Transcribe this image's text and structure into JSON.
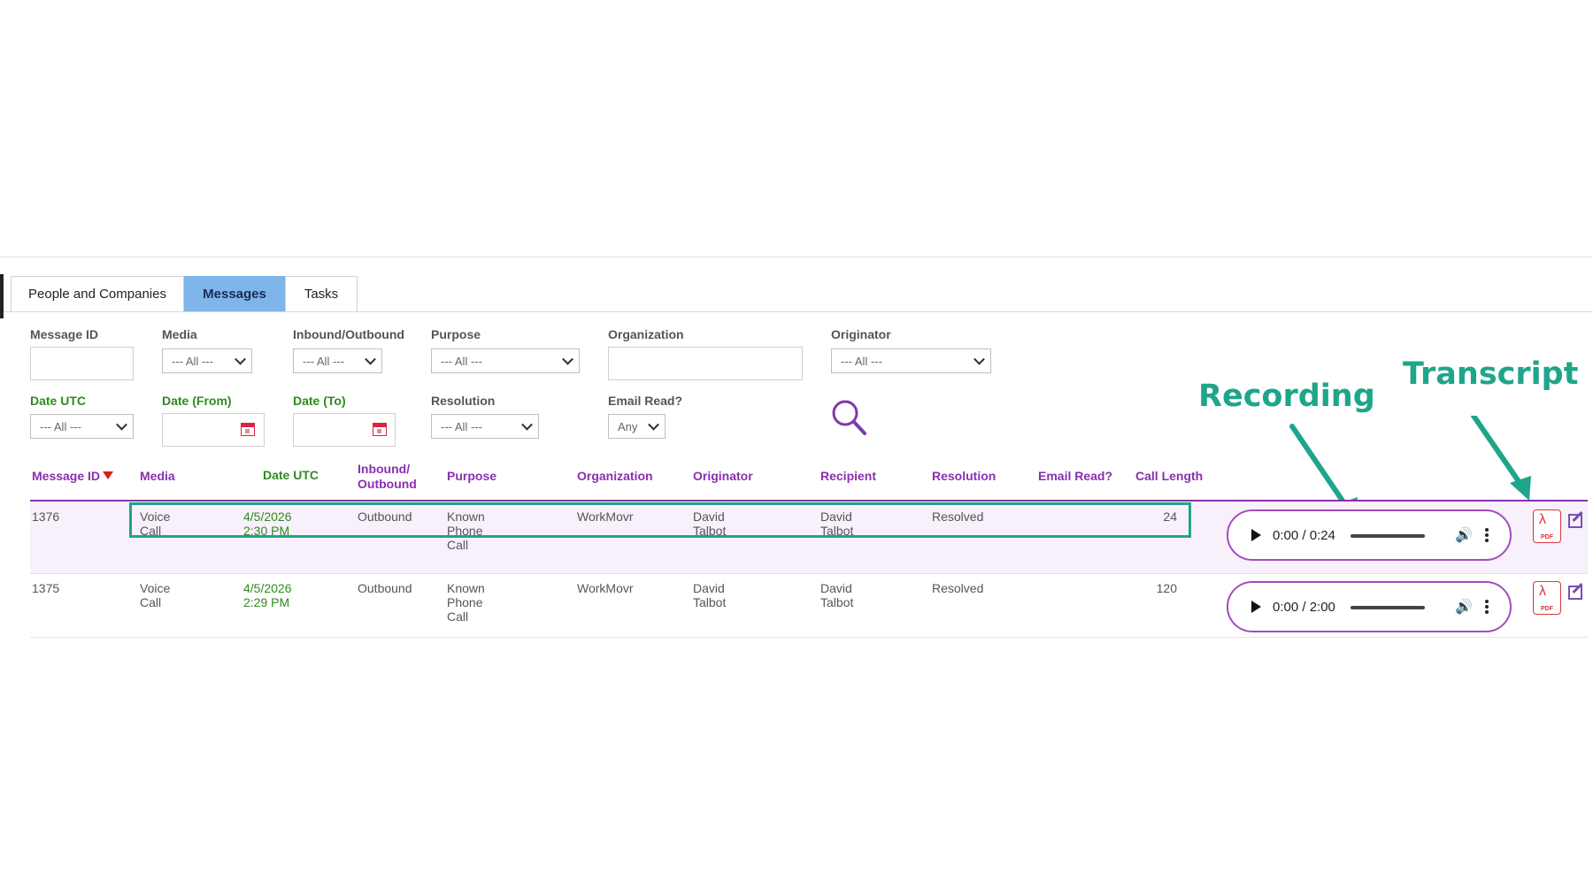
{
  "tabs": [
    {
      "label": "People and Companies",
      "active": false
    },
    {
      "label": "Messages",
      "active": true
    },
    {
      "label": "Tasks",
      "active": false
    }
  ],
  "filters": {
    "message_id": {
      "label": "Message ID",
      "value": ""
    },
    "media": {
      "label": "Media",
      "value": "--- All ---"
    },
    "inbound_outbound": {
      "label": "Inbound/Outbound",
      "value": "--- All ---"
    },
    "purpose": {
      "label": "Purpose",
      "value": "--- All ---"
    },
    "organization": {
      "label": "Organization",
      "value": ""
    },
    "originator": {
      "label": "Originator",
      "value": "--- All ---"
    },
    "date_utc": {
      "label": "Date UTC",
      "value": "--- All ---"
    },
    "date_from": {
      "label": "Date (From)",
      "value": ""
    },
    "date_to": {
      "label": "Date (To)",
      "value": ""
    },
    "resolution": {
      "label": "Resolution",
      "value": "--- All ---"
    },
    "email_read": {
      "label": "Email Read?",
      "value": "Any"
    }
  },
  "table": {
    "columns": {
      "message_id": "Message ID",
      "media": "Media",
      "date_utc": "Date UTC",
      "inbound_outbound_1": "Inbound/",
      "inbound_outbound_2": "Outbound",
      "purpose": "Purpose",
      "organization": "Organization",
      "originator": "Originator",
      "recipient": "Recipient",
      "resolution": "Resolution",
      "email_read": "Email Read?",
      "call_length": "Call Length"
    },
    "rows": [
      {
        "message_id": "1376",
        "media": "Voice Call",
        "date_utc": "4/5/2026 2:30 PM",
        "direction": "Outbound",
        "purpose": "Known Phone Call",
        "organization": "WorkMovr",
        "originator": "David Talbot",
        "recipient": "David Talbot",
        "resolution": "Resolved",
        "email_read": "",
        "call_length": "24",
        "player_time": "0:00 / 0:24"
      },
      {
        "message_id": "1375",
        "media": "Voice Call",
        "date_utc": "4/5/2026 2:29 PM",
        "direction": "Outbound",
        "purpose": "Known Phone Call",
        "organization": "WorkMovr",
        "originator": "David Talbot",
        "recipient": "David Talbot",
        "resolution": "Resolved",
        "email_read": "",
        "call_length": "120",
        "player_time": "0:00 / 2:00"
      }
    ]
  },
  "annotations": {
    "recording": "Recording",
    "transcript": "Transcript"
  },
  "colors": {
    "accent_purple": "#8a2fb0",
    "date_green": "#2e8b1e",
    "annotation_teal": "#1ea58a",
    "active_tab": "#7fb6ea"
  },
  "icons": [
    "magnifier-icon",
    "calendar-icon",
    "play-icon",
    "volume-icon",
    "more-options-icon",
    "pdf-icon",
    "edit-icon",
    "sort-desc-icon"
  ]
}
